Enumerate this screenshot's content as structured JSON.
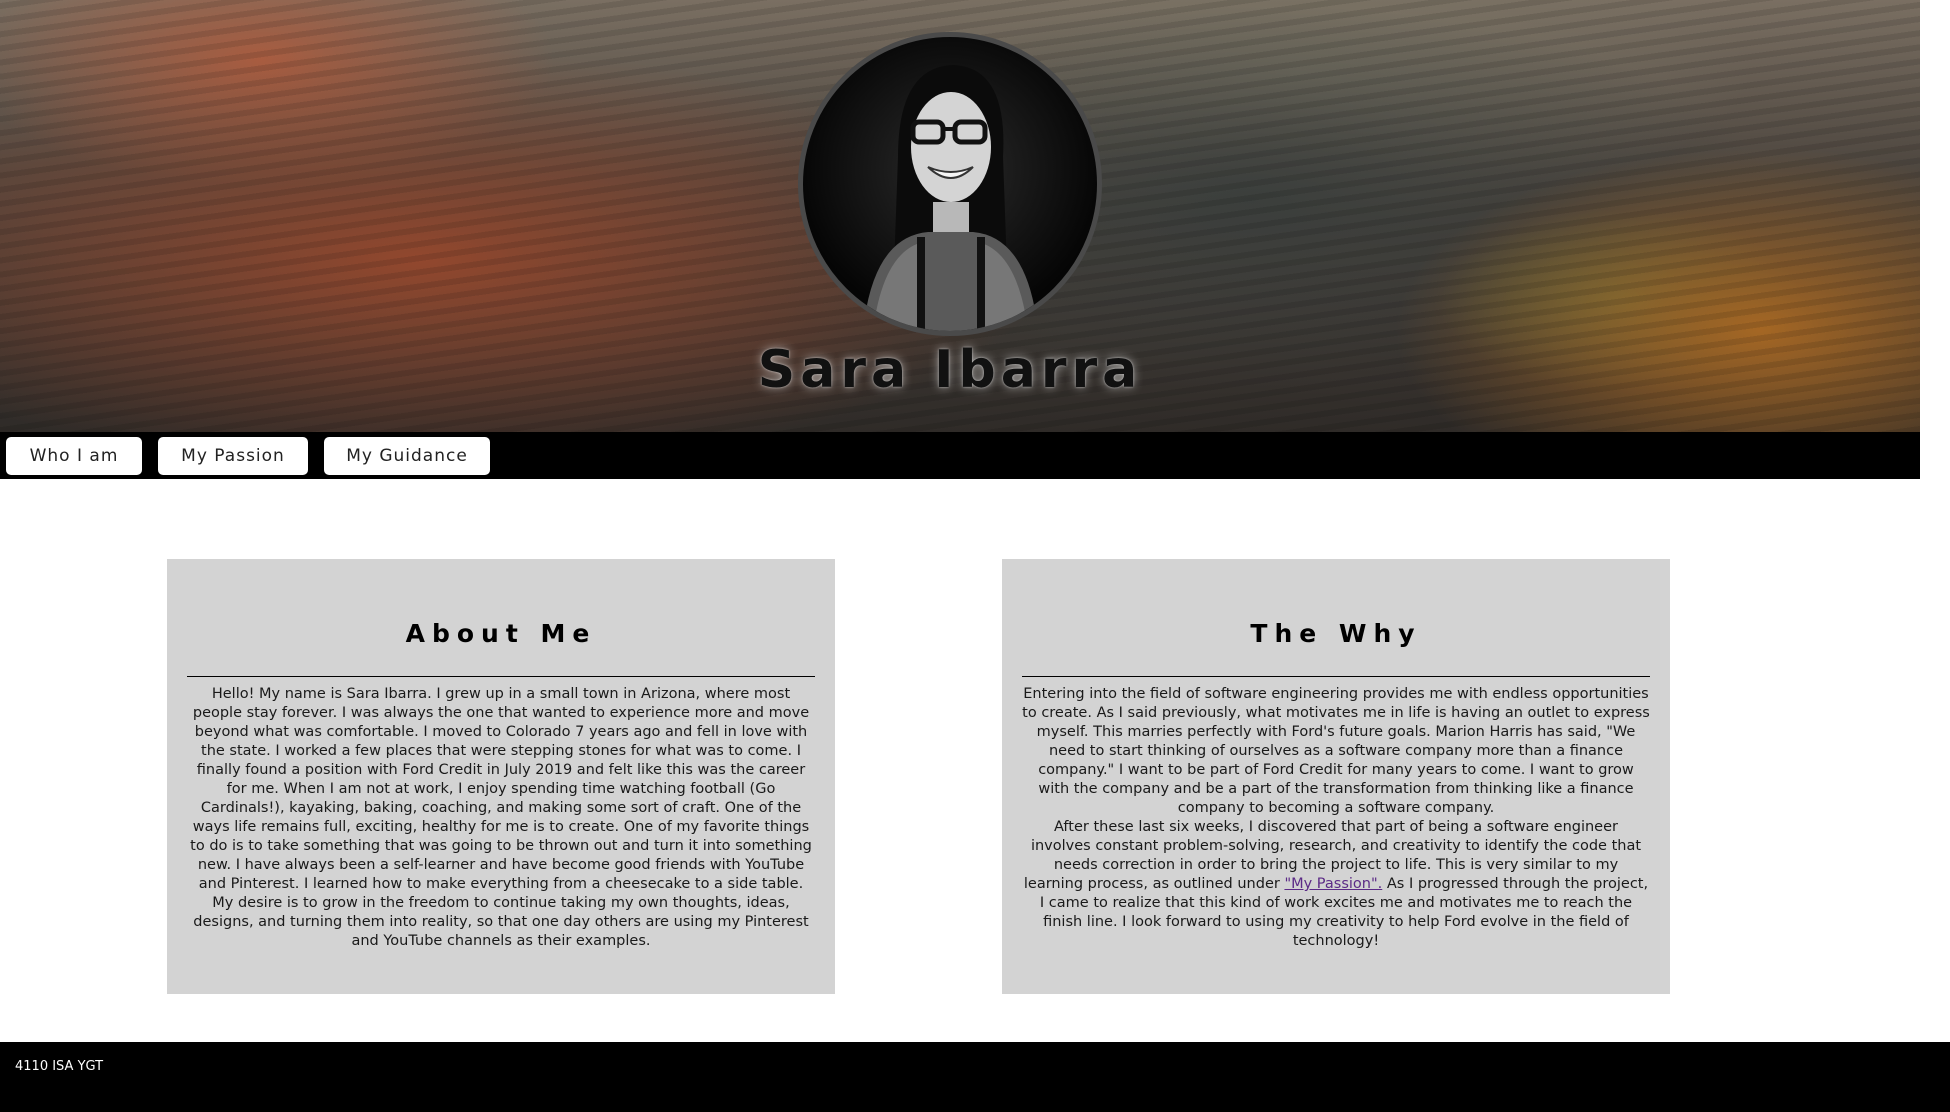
{
  "hero": {
    "name": "Sara Ibarra",
    "background_icon": "canyon-landscape",
    "avatar_icon": "profile-photo"
  },
  "nav": {
    "items": [
      {
        "label": "Who I am"
      },
      {
        "label": "My Passion"
      },
      {
        "label": "My Guidance"
      }
    ]
  },
  "about": {
    "title": "About Me",
    "body": "Hello! My name is Sara Ibarra. I grew up in a small town in Arizona, where most people stay forever. I was always the one that wanted to experience more and move beyond what was comfortable. I moved to Colorado 7 years ago and fell in love with the state. I worked a few places that were stepping stones for what was to come. I finally found a position with Ford Credit in July 2019 and felt like this was the career for me. When I am not at work, I enjoy spending time watching football (Go Cardinals!), kayaking, baking, coaching, and making some sort of craft. One of the ways life remains full, exciting, healthy for me is to create. One of my favorite things to do is to take something that was going to be thrown out and turn it into something new. I have always been a self-learner and have become good friends with YouTube and Pinterest. I learned how to make everything from a cheesecake to a side table. My desire is to grow in the freedom to continue taking my own thoughts, ideas, designs, and turning them into reality, so that one day others are using my Pinterest and YouTube channels as their examples."
  },
  "why": {
    "title": "The Why",
    "paragraph1": "Entering into the field of software engineering provides me with endless opportunities to create. As I said previously, what motivates me in life is having an outlet to express myself. This marries perfectly with Ford's future goals. Marion Harris has said, \"We need to start thinking of ourselves as a software company more than a finance company.\" I want to be part of Ford Credit for many years to come. I want to grow with the company and be a part of the transformation from thinking like a finance company to becoming a software company.",
    "paragraph2_before": "After these last six weeks, I discovered that part of being a software engineer involves constant problem-solving, research, and creativity to identify the code that needs correction in order to bring the project to life. This is very similar to my learning process, as outlined under ",
    "link_label": "\"My Passion\".",
    "paragraph2_after": " As I progressed through the project, I came to realize that this kind of work excites me and motivates me to reach the finish line. I look forward to using my creativity to help Ford evolve in the field of technology!"
  },
  "footer": {
    "text": "4110 ISA YGT"
  },
  "colors": {
    "nav_bg": "#000000",
    "card_bg": "#d3d3d3",
    "footer_bg": "#000000",
    "link": "#5b2a86"
  }
}
